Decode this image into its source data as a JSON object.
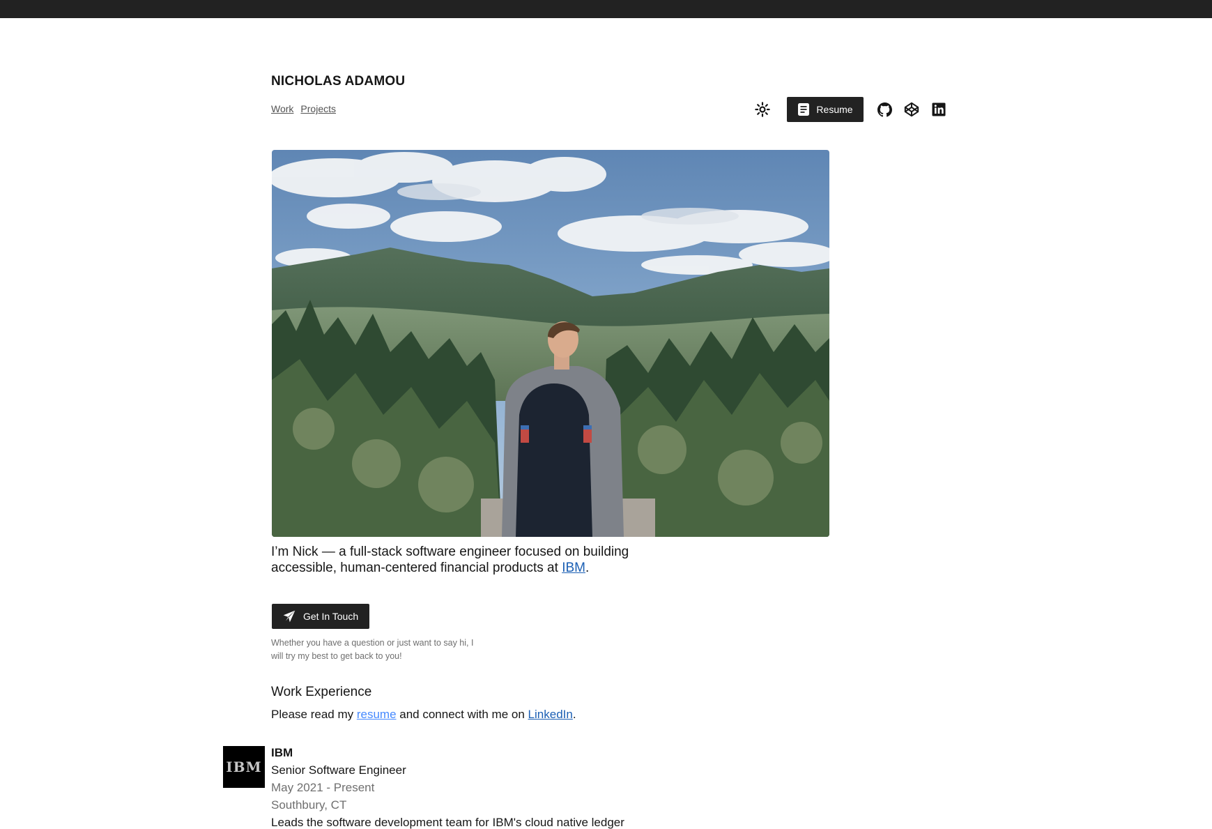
{
  "site": {
    "brand": "NICHOLAS ADAMOU",
    "nav": [
      {
        "label": "Work"
      },
      {
        "label": "Projects"
      }
    ]
  },
  "toolbar": {
    "theme_icon": "sun-icon",
    "resume_label": "Resume",
    "resume_icon": "document-icon",
    "social": [
      {
        "icon": "github-icon"
      },
      {
        "icon": "codepen-icon"
      },
      {
        "icon": "linkedin-icon"
      }
    ]
  },
  "intro": {
    "text_before": "I’m Nick — a full-stack software engineer focused on building accessible, human-centered financial products at ",
    "link_text": "IBM",
    "text_after": "."
  },
  "cta": {
    "label": "Get In Touch",
    "icon": "send-icon",
    "note": "Whether you have a question or just want to say hi, I will try my best to get back to you!"
  },
  "work": {
    "heading": "Work Experience",
    "text_before": "Please read my ",
    "resume_link": "resume",
    "text_middle": " and connect with me on ",
    "linkedin_link": "LinkedIn",
    "text_after": ".",
    "jobs": [
      {
        "logo_text": "IBM",
        "company": "IBM",
        "title": "Senior Software Engineer",
        "dates": "May 2021 - Present",
        "location": "Southbury, CT",
        "description": "Leads the software development team for IBM's cloud native ledger"
      }
    ]
  },
  "colors": {
    "topbar": "#222222",
    "button_bg": "#222222",
    "link": "#1b5fb4",
    "link_light": "#4589ff",
    "muted_text": "#6f6f6f"
  }
}
